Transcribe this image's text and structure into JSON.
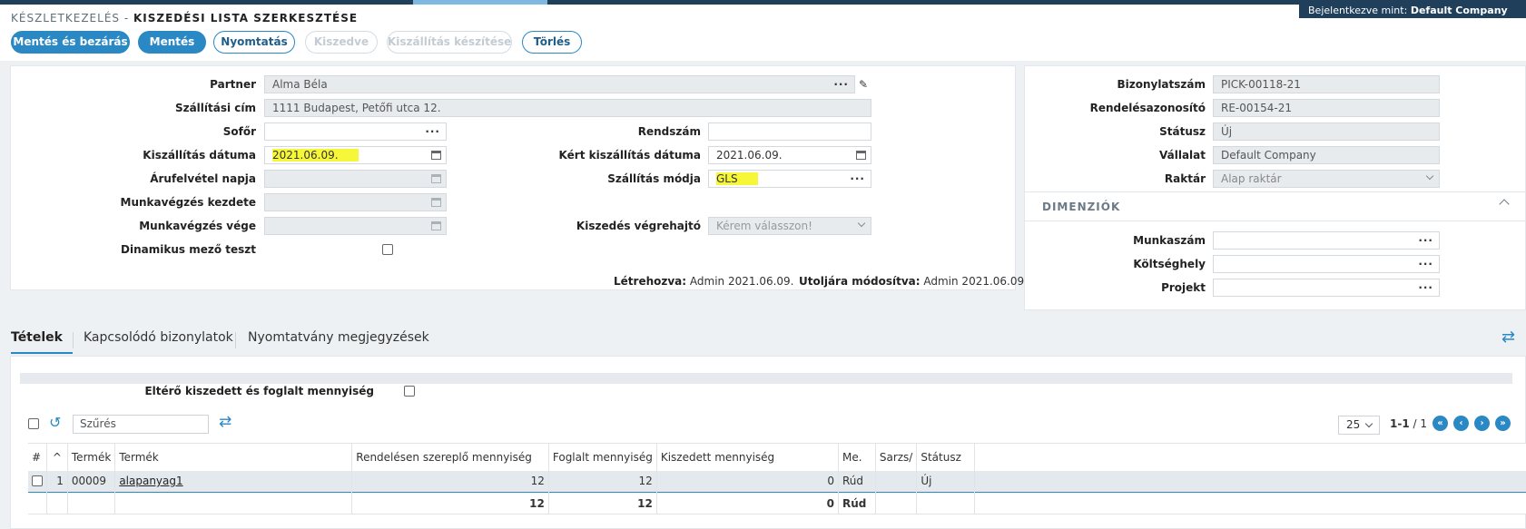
{
  "header": {
    "module": "KÉSZLETKEZELÉS -",
    "page_title": "KISZEDÉSI LISTA SZERKESZTÉSE",
    "login_prefix": "Bejelentkezve mint:",
    "login_company": "Default Company"
  },
  "toolbar": {
    "save_close": "Mentés és bezárás",
    "save": "Mentés",
    "print": "Nyomtatás",
    "picked": "Kiszedve",
    "create_shipment": "Kiszállítás készítése",
    "delete": "Törlés"
  },
  "form": {
    "partner_label": "Partner",
    "partner_value": "Alma Béla",
    "address_label": "Szállítási cím",
    "address_value": "1111 Budapest, Petőfi utca 12.",
    "driver_label": "Sofőr",
    "driver_value": "",
    "plate_label": "Rendszám",
    "plate_value": "",
    "delivery_date_label": "Kiszállítás dátuma",
    "delivery_date_value": "2021.06.09.",
    "requested_date_label": "Kért kiszállítás dátuma",
    "requested_date_value": "2021.06.09.",
    "pickup_day_label": "Árufelvétel napja",
    "shipping_method_label": "Szállítás módja",
    "shipping_method_value": "GLS",
    "work_start_label": "Munkavégzés kezdete",
    "work_end_label": "Munkavégzés vége",
    "picker_label": "Kiszedés végrehajtó",
    "picker_placeholder": "Kérem válasszon!",
    "dynamic_label": "Dinamikus mező teszt",
    "created_label": "Létrehozva:",
    "created_value": "Admin 2021.06.09.",
    "modified_label": "Utoljára módosítva:",
    "modified_value": "Admin 2021.06.09."
  },
  "side": {
    "doc_no_label": "Bizonylatszám",
    "doc_no_value": "PICK-00118-21",
    "order_id_label": "Rendelésazonosító",
    "order_id_value": "RE-00154-21",
    "status_label": "Státusz",
    "status_value": "Új",
    "company_label": "Vállalat",
    "company_value": "Default Company",
    "warehouse_label": "Raktár",
    "warehouse_value": "Alap raktár",
    "dimensions_title": "DIMENZIÓK",
    "worknumber_label": "Munkaszám",
    "costcenter_label": "Költséghely",
    "project_label": "Projekt"
  },
  "tabs": [
    {
      "label": "Tételek"
    },
    {
      "label": "Kapcsolódó bizonylatok"
    },
    {
      "label": "Nyomtatvány megjegyzések"
    }
  ],
  "items": {
    "diff_label": "Eltérő kiszedett és foglalt mennyiség",
    "filter_placeholder": "Szűrés",
    "page_size": "25",
    "page_current": "1-1",
    "page_total": "/ 1",
    "columns": [
      "#",
      "Termék",
      "Termék",
      "Rendelésen szereplő mennyiség",
      "Foglalt mennyiség",
      "Kiszedett mennyiség",
      "Me.",
      "Sarzs/",
      "Státusz"
    ],
    "rows": [
      {
        "n": "1",
        "code": "00009",
        "name": "alapanyag1",
        "ordered": "12",
        "reserved": "12",
        "picked": "0",
        "unit": "Rúd",
        "lot": "",
        "status": "Új"
      }
    ],
    "totals": {
      "ordered": "12",
      "reserved": "12",
      "picked": "0",
      "unit": "Rúd"
    }
  }
}
